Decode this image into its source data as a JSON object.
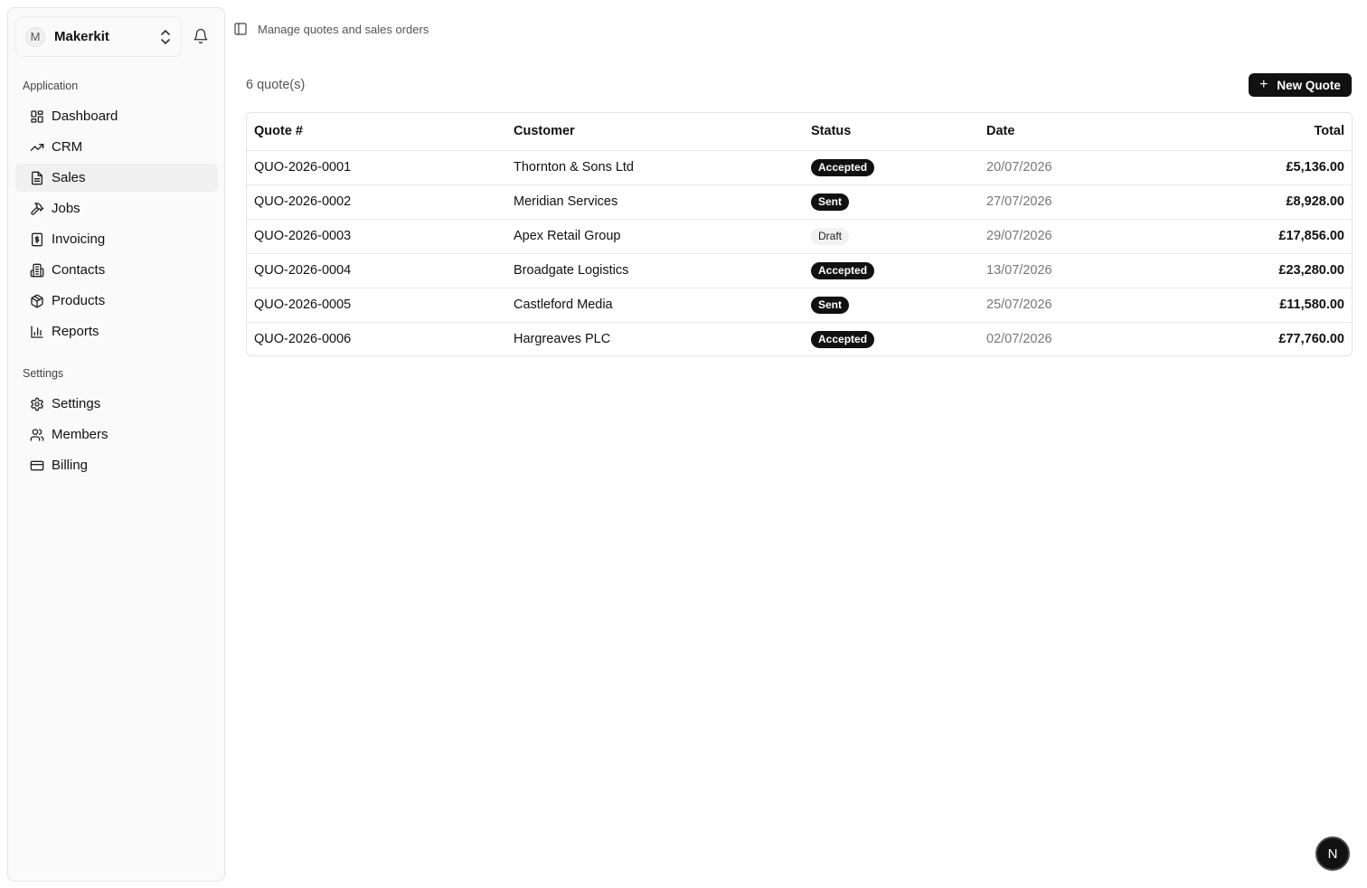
{
  "account": {
    "initial": "M",
    "name": "Makerkit"
  },
  "sidebar": {
    "sections": [
      {
        "label": "Application"
      },
      {
        "label": "Settings"
      }
    ],
    "items": [
      {
        "label": "Dashboard",
        "icon": "layout-dashboard-icon"
      },
      {
        "label": "CRM",
        "icon": "trending-up-icon"
      },
      {
        "label": "Sales",
        "icon": "file-text-icon"
      },
      {
        "label": "Jobs",
        "icon": "hammer-icon"
      },
      {
        "label": "Invoicing",
        "icon": "receipt-icon"
      },
      {
        "label": "Contacts",
        "icon": "building-icon"
      },
      {
        "label": "Products",
        "icon": "package-icon"
      },
      {
        "label": "Reports",
        "icon": "bar-chart-icon"
      },
      {
        "label": "Settings",
        "icon": "gear-icon"
      },
      {
        "label": "Members",
        "icon": "users-icon"
      },
      {
        "label": "Billing",
        "icon": "credit-card-icon"
      }
    ],
    "active": "Sales"
  },
  "header": {
    "subtitle": "Manage quotes and sales orders"
  },
  "main": {
    "count_label": "6 quote(s)",
    "new_button": "New Quote"
  },
  "table": {
    "columns": [
      "Quote #",
      "Customer",
      "Status",
      "Date",
      "Total"
    ],
    "rows": [
      {
        "quote": "QUO-2026-0001",
        "customer": "Thornton & Sons Ltd",
        "status": "Accepted",
        "date": "20/07/2026",
        "total": "£5,136.00"
      },
      {
        "quote": "QUO-2026-0002",
        "customer": "Meridian Services",
        "status": "Sent",
        "date": "27/07/2026",
        "total": "£8,928.00"
      },
      {
        "quote": "QUO-2026-0003",
        "customer": "Apex Retail Group",
        "status": "Draft",
        "date": "29/07/2026",
        "total": "£17,856.00"
      },
      {
        "quote": "QUO-2026-0004",
        "customer": "Broadgate Logistics",
        "status": "Accepted",
        "date": "13/07/2026",
        "total": "£23,280.00"
      },
      {
        "quote": "QUO-2026-0005",
        "customer": "Castleford Media",
        "status": "Sent",
        "date": "25/07/2026",
        "total": "£11,580.00"
      },
      {
        "quote": "QUO-2026-0006",
        "customer": "Hargreaves PLC",
        "status": "Accepted",
        "date": "02/07/2026",
        "total": "£77,760.00"
      }
    ]
  },
  "dev_badge": {
    "letter": "N"
  },
  "colors": {
    "primary": "#111111",
    "sidebar_bg": "#fafafa",
    "muted_text": "#777777"
  }
}
